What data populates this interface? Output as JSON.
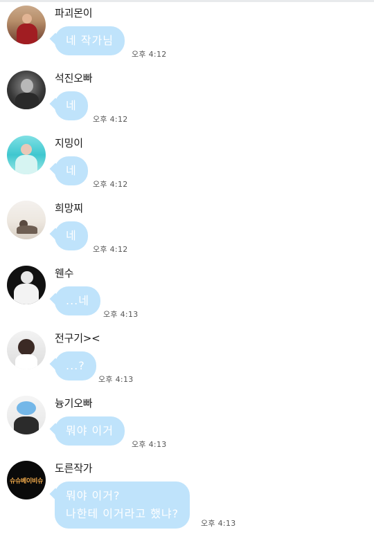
{
  "messages": [
    {
      "sender": "파괴몬이",
      "text": "네 작가님",
      "time": "오후 4:12"
    },
    {
      "sender": "석진오빠",
      "text": "네",
      "time": "오후 4:12"
    },
    {
      "sender": "지밍이",
      "text": "네",
      "time": "오후 4:12"
    },
    {
      "sender": "희망찌",
      "text": "네",
      "time": "오후 4:12"
    },
    {
      "sender": "웬수",
      "text": "...네",
      "time": "오후 4:13"
    },
    {
      "sender": "전구기><",
      "text": "...?",
      "time": "오후 4:13"
    },
    {
      "sender": "늉기오빠",
      "text": "뭐야 이거",
      "time": "오후 4:13"
    },
    {
      "sender": "도른작가",
      "lines": [
        "뭐야 이거?",
        "나한테 이거라고 했냐?"
      ],
      "time": "오후 4:13"
    }
  ],
  "avatar_logo_text": "슈슈베이비슈",
  "colors": {
    "bubble": "#bfe3fb",
    "bubble_text": "#ffffff",
    "time": "#555555",
    "background": "#ffffff"
  }
}
